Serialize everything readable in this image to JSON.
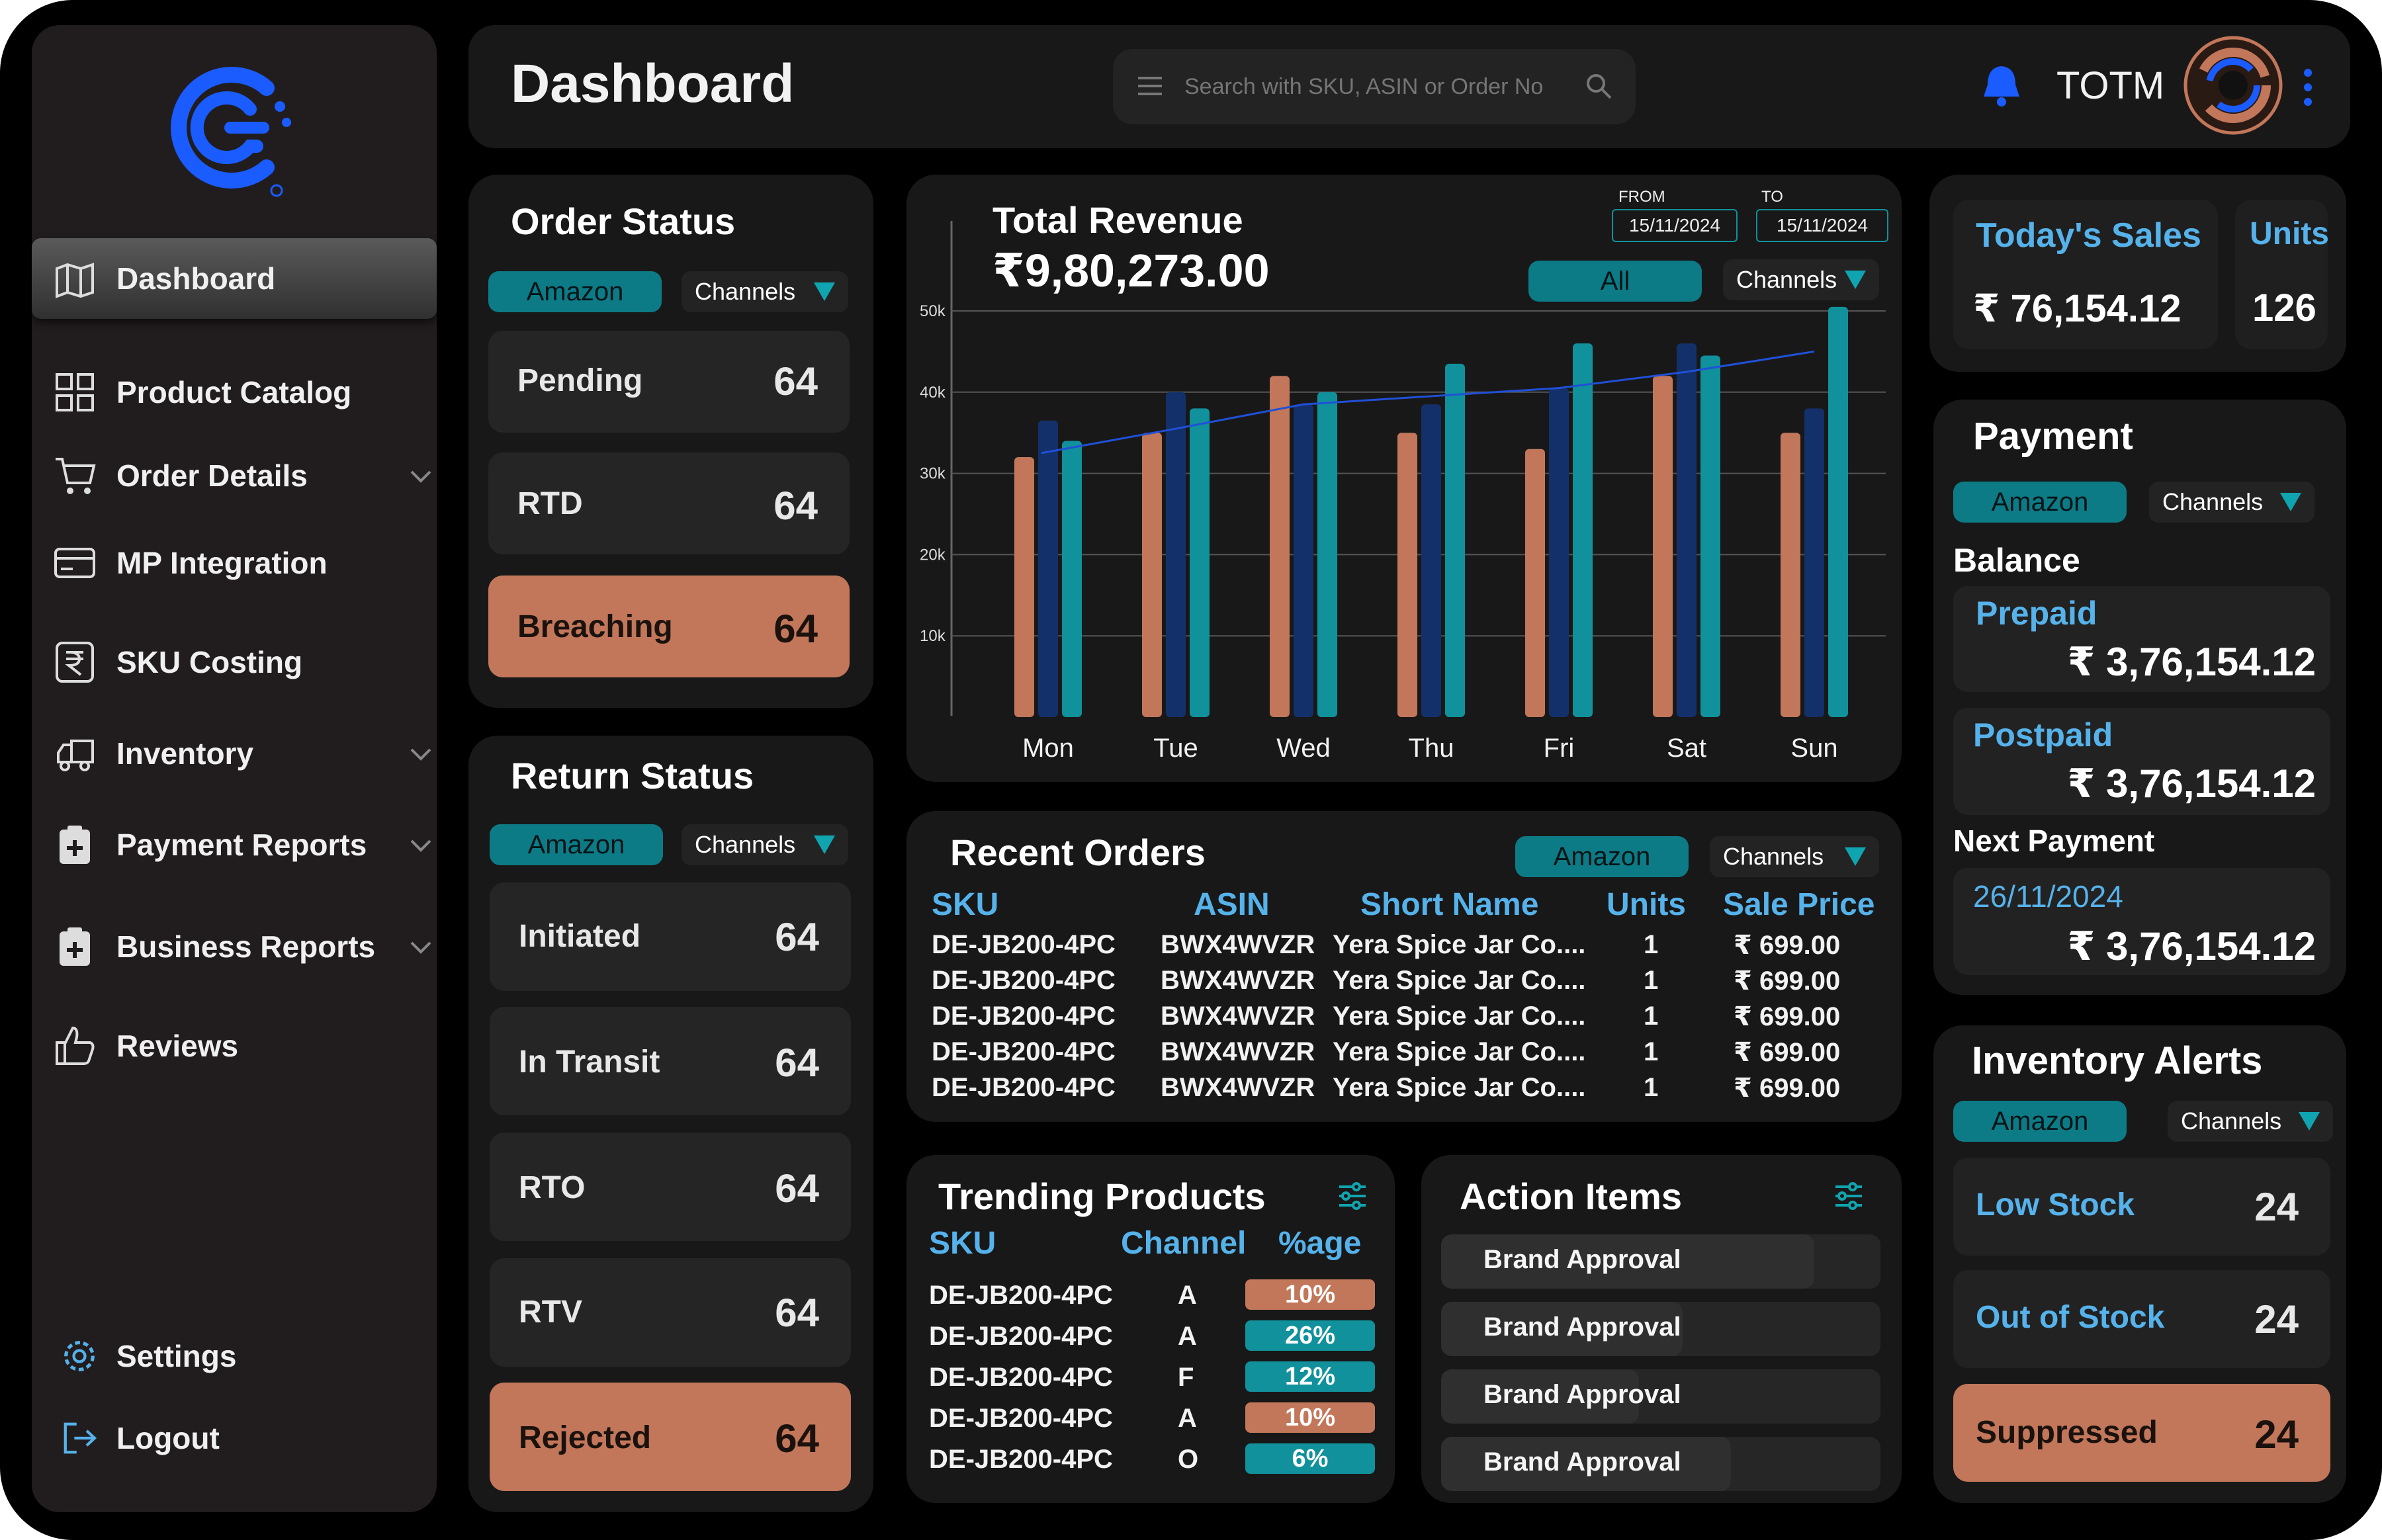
{
  "app": {
    "title": "Dashboard",
    "search_placeholder": "Search with SKU, ASIN or Order No",
    "user": "TOTM"
  },
  "sidebar": {
    "items": [
      {
        "label": "Dashboard",
        "icon": "map-icon"
      },
      {
        "label": "Product Catalog",
        "icon": "grid-icon"
      },
      {
        "label": "Order Details",
        "icon": "cart-icon"
      },
      {
        "label": "MP Integration",
        "icon": "card-icon"
      },
      {
        "label": "SKU Costing",
        "icon": "rupee-doc-icon"
      },
      {
        "label": "Inventory",
        "icon": "truck-icon"
      },
      {
        "label": "Payment Reports",
        "icon": "clipboard-plus-icon"
      },
      {
        "label": "Business Reports",
        "icon": "clipboard-plus-icon"
      },
      {
        "label": "Reviews",
        "icon": "thumbs-up-icon"
      }
    ],
    "settings": "Settings",
    "logout": "Logout"
  },
  "filter": {
    "amazon": "Amazon",
    "channels": "Channels",
    "all": "All"
  },
  "order_status": {
    "title": "Order Status",
    "rows": [
      {
        "label": "Pending",
        "value": "64"
      },
      {
        "label": "RTD",
        "value": "64"
      },
      {
        "label": "Breaching",
        "value": "64"
      }
    ]
  },
  "return_status": {
    "title": "Return Status",
    "rows": [
      {
        "label": "Initiated",
        "value": "64"
      },
      {
        "label": "In Transit",
        "value": "64"
      },
      {
        "label": "RTO",
        "value": "64"
      },
      {
        "label": "RTV",
        "value": "64"
      },
      {
        "label": "Rejected",
        "value": "64"
      }
    ]
  },
  "revenue": {
    "title": "Total Revenue",
    "amount": "₹9,80,273.00",
    "from_label": "FROM",
    "to_label": "TO",
    "from": "15/11/2024",
    "to": "15/11/2024"
  },
  "chart_data": {
    "type": "bar",
    "categories": [
      "Mon",
      "Tue",
      "Wed",
      "Thu",
      "Fri",
      "Sat",
      "Sun"
    ],
    "series": [
      {
        "values": [
          32000,
          35000,
          42000,
          35000,
          33000,
          42000,
          35000
        ],
        "color": "#c2775a"
      },
      {
        "values": [
          36500,
          40000,
          38500,
          38500,
          40500,
          46000,
          38000
        ],
        "color": "#14306a"
      },
      {
        "values": [
          34000,
          38000,
          40000,
          43500,
          46000,
          44500,
          50500
        ],
        "color": "#10919b"
      }
    ],
    "trend": [
      32500,
      35500,
      38500,
      39500,
      40500,
      42500,
      45000
    ],
    "yticks": [
      "10k",
      "20k",
      "30k",
      "40k",
      "50k"
    ],
    "ylim": [
      0,
      50000
    ]
  },
  "recent_orders": {
    "title": "Recent Orders",
    "headers": [
      "SKU",
      "ASIN",
      "Short Name",
      "Units",
      "Sale Price"
    ],
    "rows": [
      [
        "DE-JB200-4PC",
        "BWX4WVZR",
        "Yera Spice Jar Co....",
        "1",
        "₹ 699.00"
      ],
      [
        "DE-JB200-4PC",
        "BWX4WVZR",
        "Yera Spice Jar Co....",
        "1",
        "₹ 699.00"
      ],
      [
        "DE-JB200-4PC",
        "BWX4WVZR",
        "Yera Spice Jar Co....",
        "1",
        "₹ 699.00"
      ],
      [
        "DE-JB200-4PC",
        "BWX4WVZR",
        "Yera Spice Jar Co....",
        "1",
        "₹ 699.00"
      ],
      [
        "DE-JB200-4PC",
        "BWX4WVZR",
        "Yera Spice Jar Co....",
        "1",
        "₹ 699.00"
      ]
    ]
  },
  "trending": {
    "title": "Trending Products",
    "headers": [
      "SKU",
      "Channel",
      "%age"
    ],
    "rows": [
      {
        "sku": "DE-JB200-4PC",
        "ch": "A",
        "pct": "10%",
        "color": "#c2775a"
      },
      {
        "sku": "DE-JB200-4PC",
        "ch": "A",
        "pct": "26%",
        "color": "#10919b"
      },
      {
        "sku": "DE-JB200-4PC",
        "ch": "F",
        "pct": "12%",
        "color": "#10919b"
      },
      {
        "sku": "DE-JB200-4PC",
        "ch": "A",
        "pct": "10%",
        "color": "#c2775a"
      },
      {
        "sku": "DE-JB200-4PC",
        "ch": "O",
        "pct": "6%",
        "color": "#10919b"
      }
    ]
  },
  "actions": {
    "title": "Action Items",
    "items": [
      {
        "label": "Brand Approval",
        "progress": 0.85
      },
      {
        "label": "Brand Approval",
        "progress": 0.55
      },
      {
        "label": "Brand Approval",
        "progress": 0.45
      },
      {
        "label": "Brand Approval",
        "progress": 0.66
      }
    ]
  },
  "today": {
    "title": "Today's Sales",
    "amount": "₹ 76,154.12",
    "units_title": "Units",
    "units": "126"
  },
  "payment": {
    "title": "Payment",
    "balance": "Balance",
    "prepaid": "Prepaid",
    "prepaid_amt": "₹ 3,76,154.12",
    "postpaid": "Postpaid",
    "postpaid_amt": "₹ 3,76,154.12",
    "next": "Next Payment",
    "next_date": "26/11/2024",
    "next_amt": "₹ 3,76,154.12"
  },
  "inventory": {
    "title": "Inventory Alerts",
    "rows": [
      {
        "label": "Low Stock",
        "value": "24"
      },
      {
        "label": "Out of Stock",
        "value": "24"
      },
      {
        "label": "Suppressed",
        "value": "24"
      }
    ]
  }
}
